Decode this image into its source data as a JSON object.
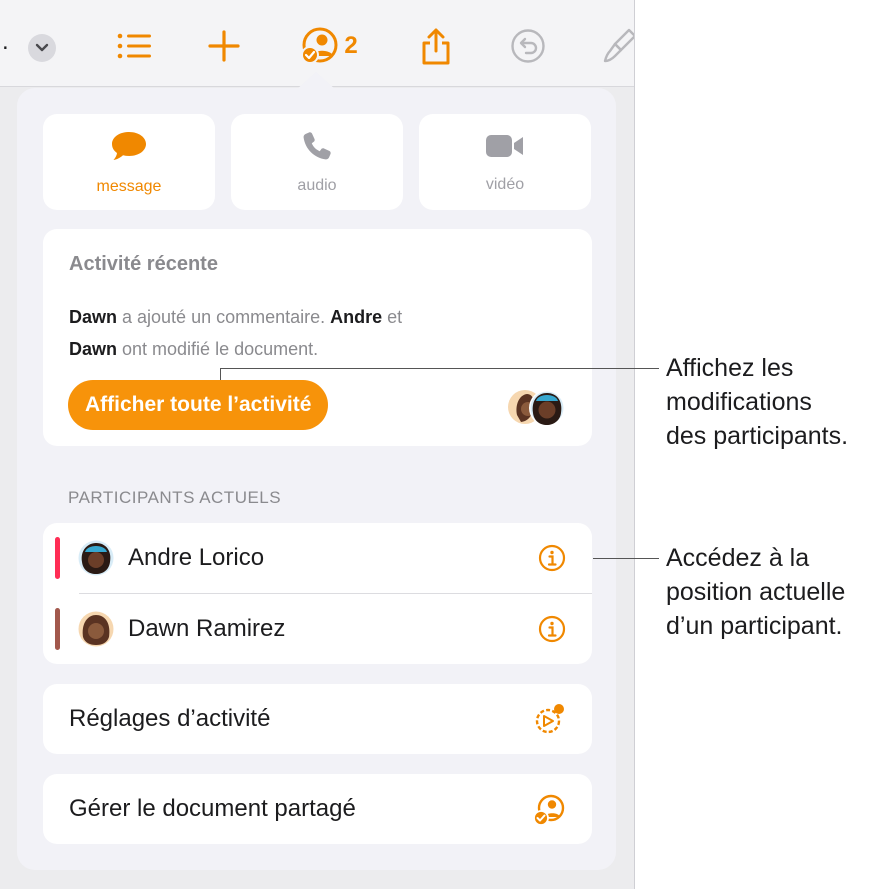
{
  "toolbar": {
    "more": ".",
    "collaborator_count": "2",
    "icons": [
      "chevron-down-icon",
      "list-icon",
      "plus-icon",
      "collaboration-icon",
      "share-icon",
      "undo-icon",
      "brush-icon"
    ]
  },
  "communication": [
    {
      "label": "message",
      "icon": "speech-bubble-icon",
      "active": true
    },
    {
      "label": "audio",
      "icon": "phone-icon",
      "active": false
    },
    {
      "label": "vidéo",
      "icon": "video-camera-icon",
      "active": false
    }
  ],
  "activity": {
    "title": "Activité récente",
    "name1": "Dawn",
    "text1": " a ajouté un commentaire. ",
    "name2": "Andre",
    "text2": " et ",
    "name3": "Dawn",
    "text3": " ont modifié le document.",
    "button": "Afficher toute l’activité"
  },
  "participants": {
    "header": "PARTICIPANTS ACTUELS",
    "list": [
      {
        "name": "Andre Lorico",
        "bar_color": "#ff2d55"
      },
      {
        "name": "Dawn Ramirez",
        "bar_color": "#a2584c"
      }
    ]
  },
  "menu": {
    "activity_settings": "Réglages d’activité",
    "manage_shared": "Gérer le document partagé"
  },
  "callouts": {
    "first": [
      "Affichez les",
      "modifications",
      "des participants."
    ],
    "second": [
      "Accédez à la",
      "position actuelle",
      "d’un participant."
    ]
  },
  "colors": {
    "accent": "#f7930a",
    "icon_orange": "#f08800"
  }
}
